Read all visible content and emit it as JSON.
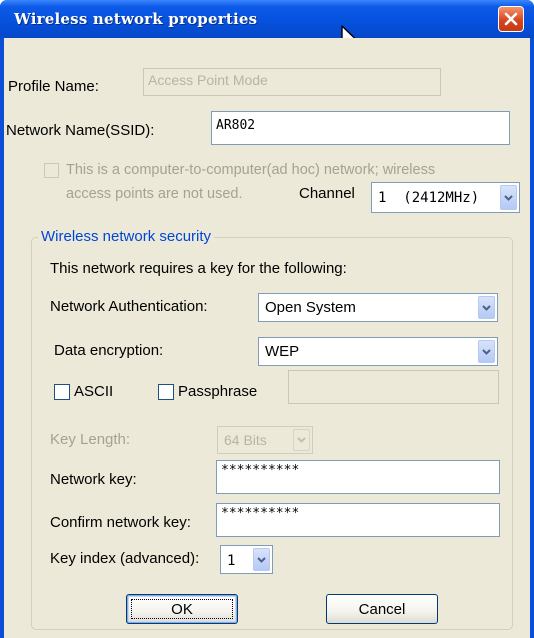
{
  "window": {
    "title": "Wireless network properties"
  },
  "profile": {
    "label": "Profile Name:",
    "value": "Access Point Mode"
  },
  "ssid": {
    "label": "Network Name(SSID):",
    "value": "AR802"
  },
  "adhoc": {
    "text_line1": "This is a computer-to-computer(ad hoc) network; wireless",
    "text_line2": "access points are not used.",
    "checked": false
  },
  "channel": {
    "label": "Channel",
    "value": "1  (2412MHz)"
  },
  "security": {
    "group_title": "Wireless network security",
    "requires_text": "This network requires a key for the following:",
    "auth_label": "Network Authentication:",
    "auth_value": "Open System",
    "encryption_label": "Data encryption:",
    "encryption_value": "WEP",
    "ascii_label": "ASCII",
    "passphrase_label": "Passphrase",
    "passphrase_value": "",
    "key_length_label": "Key Length:",
    "key_length_value": "64 Bits",
    "network_key_label": "Network key:",
    "network_key_value": "**********",
    "confirm_key_label": "Confirm network key:",
    "confirm_key_value": "**********",
    "key_index_label": "Key index (advanced):",
    "key_index_value": "1"
  },
  "buttons": {
    "ok": "OK",
    "cancel": "Cancel"
  },
  "icons": {
    "close": "close-icon",
    "cursor": "mouse-cursor-icon",
    "dropdown": "chevron-down-icon"
  },
  "colors": {
    "titlebar": "#0550dc",
    "close": "#d8461f",
    "group_title": "#0046d5",
    "dialog_bg": "#ece9d8"
  }
}
